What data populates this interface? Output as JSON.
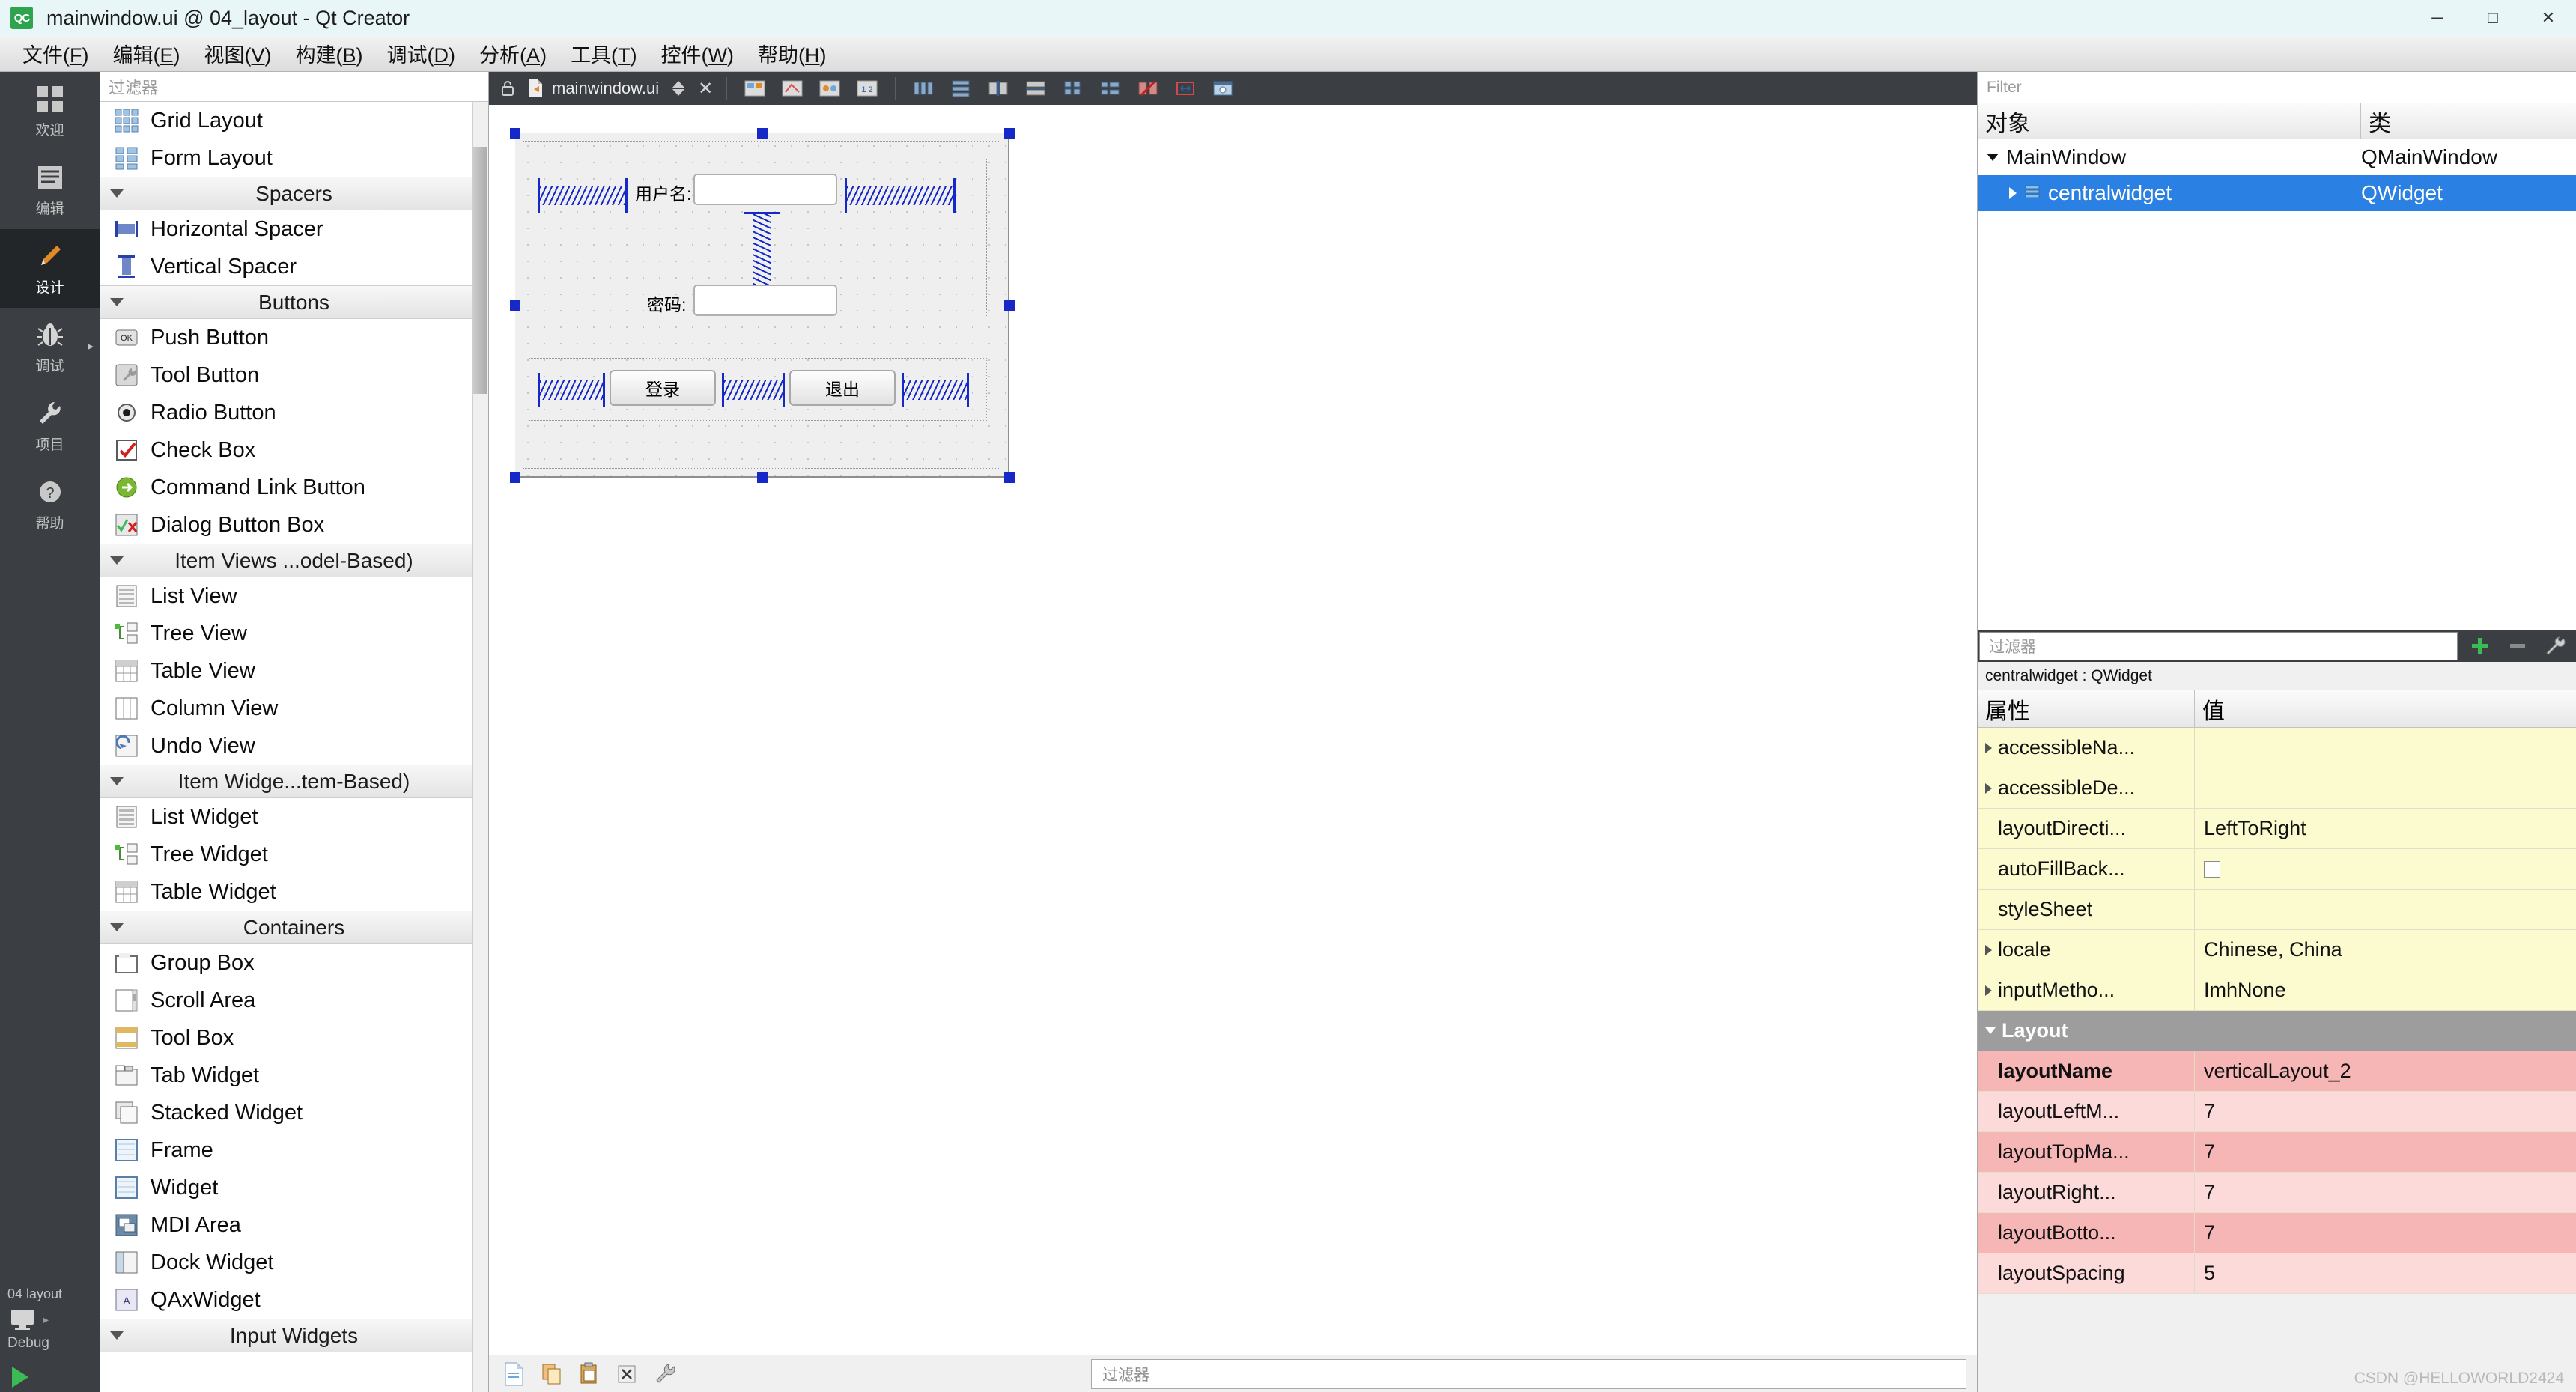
{
  "window": {
    "title": "mainwindow.ui @ 04_layout - Qt Creator",
    "logo_text": "QC",
    "minimize": "─",
    "maximize": "□",
    "close": "✕"
  },
  "menubar": {
    "items": [
      {
        "label": "文件(F)",
        "name": "menu-file"
      },
      {
        "label": "编辑(E)",
        "name": "menu-edit"
      },
      {
        "label": "视图(V)",
        "name": "menu-view"
      },
      {
        "label": "构建(B)",
        "name": "menu-build"
      },
      {
        "label": "调试(D)",
        "name": "menu-debug"
      },
      {
        "label": "分析(A)",
        "name": "menu-analyze"
      },
      {
        "label": "工具(T)",
        "name": "menu-tools"
      },
      {
        "label": "控件(W)",
        "name": "menu-widgets"
      },
      {
        "label": "帮助(H)",
        "name": "menu-help"
      }
    ]
  },
  "modebar": {
    "modes": [
      {
        "label": "欢迎",
        "icon": "grid-icon",
        "active": false
      },
      {
        "label": "编辑",
        "icon": "lines-icon",
        "active": false
      },
      {
        "label": "设计",
        "icon": "pencil-icon",
        "active": true
      },
      {
        "label": "调试",
        "icon": "bug-icon",
        "active": false
      },
      {
        "label": "项目",
        "icon": "wrench-icon",
        "active": false
      },
      {
        "label": "帮助",
        "icon": "question-icon",
        "active": false
      }
    ],
    "run_config": "04 layout",
    "kit_label": "Debug"
  },
  "widgetbox": {
    "filter_placeholder": "过滤器",
    "entries": [
      {
        "type": "item",
        "label": "Grid Layout",
        "icon": "grid-layout-icon"
      },
      {
        "type": "item",
        "label": "Form Layout",
        "icon": "form-layout-icon"
      },
      {
        "type": "group",
        "label": "Spacers"
      },
      {
        "type": "item",
        "label": "Horizontal Spacer",
        "icon": "hspacer-icon"
      },
      {
        "type": "item",
        "label": "Vertical Spacer",
        "icon": "vspacer-icon"
      },
      {
        "type": "group",
        "label": "Buttons"
      },
      {
        "type": "item",
        "label": "Push Button",
        "icon": "push-button-icon"
      },
      {
        "type": "item",
        "label": "Tool Button",
        "icon": "tool-button-icon"
      },
      {
        "type": "item",
        "label": "Radio Button",
        "icon": "radio-button-icon"
      },
      {
        "type": "item",
        "label": "Check Box",
        "icon": "check-box-icon"
      },
      {
        "type": "item",
        "label": "Command Link Button",
        "icon": "command-link-icon"
      },
      {
        "type": "item",
        "label": "Dialog Button Box",
        "icon": "dialog-button-box-icon"
      },
      {
        "type": "group",
        "label": "Item Views ...odel-Based)"
      },
      {
        "type": "item",
        "label": "List View",
        "icon": "list-view-icon"
      },
      {
        "type": "item",
        "label": "Tree View",
        "icon": "tree-view-icon"
      },
      {
        "type": "item",
        "label": "Table View",
        "icon": "table-view-icon"
      },
      {
        "type": "item",
        "label": "Column View",
        "icon": "column-view-icon"
      },
      {
        "type": "item",
        "label": "Undo View",
        "icon": "undo-view-icon"
      },
      {
        "type": "group",
        "label": "Item Widge...tem-Based)"
      },
      {
        "type": "item",
        "label": "List Widget",
        "icon": "list-widget-icon"
      },
      {
        "type": "item",
        "label": "Tree Widget",
        "icon": "tree-widget-icon"
      },
      {
        "type": "item",
        "label": "Table Widget",
        "icon": "table-widget-icon"
      },
      {
        "type": "group",
        "label": "Containers"
      },
      {
        "type": "item",
        "label": "Group Box",
        "icon": "group-box-icon"
      },
      {
        "type": "item",
        "label": "Scroll Area",
        "icon": "scroll-area-icon"
      },
      {
        "type": "item",
        "label": "Tool Box",
        "icon": "tool-box-icon"
      },
      {
        "type": "item",
        "label": "Tab Widget",
        "icon": "tab-widget-icon"
      },
      {
        "type": "item",
        "label": "Stacked Widget",
        "icon": "stacked-widget-icon"
      },
      {
        "type": "item",
        "label": "Frame",
        "icon": "frame-icon"
      },
      {
        "type": "item",
        "label": "Widget",
        "icon": "widget-icon"
      },
      {
        "type": "item",
        "label": "MDI Area",
        "icon": "mdi-area-icon"
      },
      {
        "type": "item",
        "label": "Dock Widget",
        "icon": "dock-widget-icon"
      },
      {
        "type": "item",
        "label": "QAxWidget",
        "icon": "qax-widget-icon"
      },
      {
        "type": "group",
        "label": "Input Widgets"
      }
    ]
  },
  "editor": {
    "file_tab": "mainwindow.ui",
    "toolbar_icons": [
      "edit-widgets-icon",
      "edit-signals-icon",
      "edit-buddies-icon",
      "edit-tab-order-icon",
      "layout-horizontal-icon",
      "layout-vertical-icon",
      "layout-splitter-h-icon",
      "layout-splitter-v-icon",
      "layout-grid-icon",
      "layout-form-icon",
      "break-layout-icon",
      "adjust-size-icon",
      "preview-icon"
    ]
  },
  "form": {
    "username_label": "用户名:",
    "password_label": "密码:",
    "login_button": "登录",
    "exit_button": "退出",
    "username_value": "",
    "password_value": ""
  },
  "bottombar": {
    "icons": [
      "new-file-icon",
      "copy-icon",
      "paste-icon",
      "close-icon",
      "build-icon"
    ],
    "filter_placeholder": "过滤器"
  },
  "object_inspector": {
    "filter_placeholder": "Filter",
    "columns": [
      "对象",
      "类"
    ],
    "rows": [
      {
        "name": "MainWindow",
        "class": "QMainWindow",
        "depth": 0,
        "expanded": true,
        "selected": false
      },
      {
        "name": "centralwidget",
        "class": "QWidget",
        "depth": 1,
        "expanded": false,
        "selected": true
      }
    ]
  },
  "property_editor": {
    "filter_placeholder": "过滤器",
    "subject": "centralwidget : QWidget",
    "columns": [
      "属性",
      "值"
    ],
    "toolbar_icons": [
      "add-icon",
      "remove-icon",
      "configure-icon"
    ],
    "rows": [
      {
        "prop": "accessibleNa...",
        "value": "",
        "style": "y",
        "expandable": true
      },
      {
        "prop": "accessibleDe...",
        "value": "",
        "style": "y",
        "expandable": true
      },
      {
        "prop": "layoutDirecti...",
        "value": "LeftToRight",
        "style": "y",
        "expandable": false
      },
      {
        "prop": "autoFillBack...",
        "value": "",
        "style": "y",
        "expandable": false,
        "checkbox": true
      },
      {
        "prop": "styleSheet",
        "value": "",
        "style": "y",
        "expandable": false
      },
      {
        "prop": "locale",
        "value": "Chinese, China",
        "style": "y",
        "expandable": true
      },
      {
        "prop": "inputMetho...",
        "value": "ImhNone",
        "style": "y",
        "expandable": true
      },
      {
        "prop": "Layout",
        "value": "",
        "style": "group",
        "expandable": true,
        "group": true
      },
      {
        "prop": "layoutName",
        "value": "verticalLayout_2",
        "style": "p1",
        "expandable": false,
        "bold": true
      },
      {
        "prop": "layoutLeftM...",
        "value": "7",
        "style": "p2",
        "expandable": false
      },
      {
        "prop": "layoutTopMa...",
        "value": "7",
        "style": "p1",
        "expandable": false
      },
      {
        "prop": "layoutRight...",
        "value": "7",
        "style": "p2",
        "expandable": false
      },
      {
        "prop": "layoutBotto...",
        "value": "7",
        "style": "p1",
        "expandable": false
      },
      {
        "prop": "layoutSpacing",
        "value": "5",
        "style": "p2",
        "expandable": false
      }
    ],
    "watermark": "CSDN @HELLOWORLD2424"
  }
}
